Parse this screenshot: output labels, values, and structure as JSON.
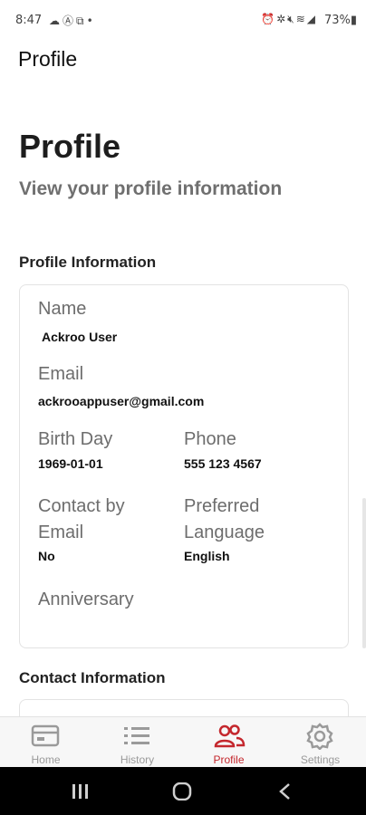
{
  "status_bar": {
    "time": "8:47",
    "left_icons": [
      "cloud-icon",
      "a-badge-icon",
      "n-badge-icon",
      "dot-icon"
    ],
    "right_icons": [
      "alarm-icon",
      "settings-small-icon",
      "mute-icon",
      "wifi-icon",
      "signal-icon"
    ],
    "battery": "73%"
  },
  "app_bar": {
    "title": "Profile"
  },
  "header": {
    "title": "Profile",
    "subtitle": "View your profile information"
  },
  "profile_section": {
    "title": "Profile Information",
    "fields": {
      "name": {
        "label": "Name",
        "value": "Ackroo User"
      },
      "email": {
        "label": "Email",
        "value": "ackrooappuser@gmail.com"
      },
      "birthday": {
        "label": "Birth Day",
        "value": "1969-01-01"
      },
      "phone": {
        "label": "Phone",
        "value": "555 123 4567"
      },
      "contact_by_email": {
        "label_line1": "Contact by",
        "label_line2": "Email",
        "value": "No"
      },
      "preferred_language": {
        "label_line1": "Preferred",
        "label_line2": "Language",
        "value": "English"
      },
      "anniversary": {
        "label": "Anniversary",
        "value": ""
      }
    }
  },
  "contact_section": {
    "title": "Contact Information"
  },
  "bottom_nav": {
    "items": [
      {
        "label": "Home",
        "icon": "card-icon",
        "active": false
      },
      {
        "label": "History",
        "icon": "list-icon",
        "active": false
      },
      {
        "label": "Profile",
        "icon": "people-icon",
        "active": true
      },
      {
        "label": "Settings",
        "icon": "gear-icon",
        "active": false
      }
    ]
  },
  "colors": {
    "accent": "#c4272d",
    "inactive": "#9a9a9a",
    "label": "#6d6d6d"
  },
  "system_nav": [
    "recent-apps-icon",
    "home-icon",
    "back-icon"
  ]
}
